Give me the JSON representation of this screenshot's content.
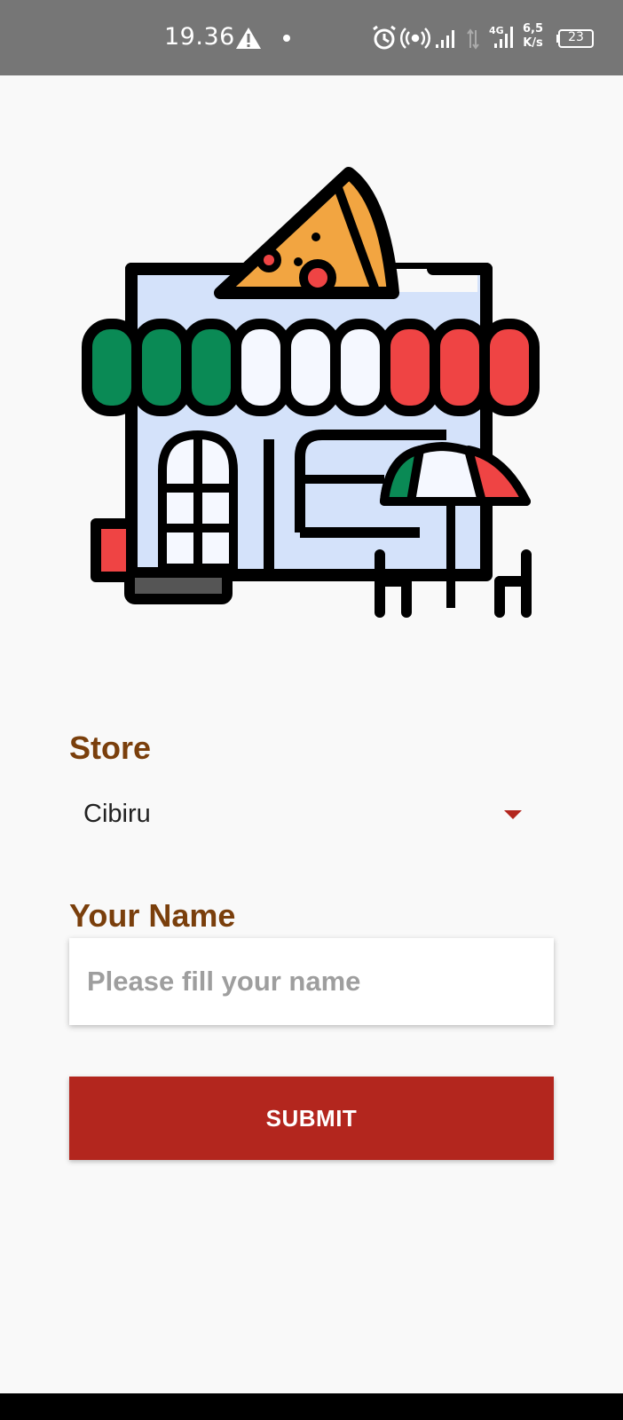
{
  "status_bar": {
    "time": "19.36",
    "network_type": "4G",
    "speed_value": "6,5",
    "speed_unit": "K/s",
    "battery": "23",
    "icons": [
      "warning-icon",
      "dot-icon",
      "alarm-icon",
      "hotspot-icon",
      "signal-icon",
      "data-arrows-icon",
      "signal-4g-icon",
      "battery-icon"
    ]
  },
  "illustration": {
    "name": "pizza-store-icon",
    "colors": {
      "green": "#0a8a55",
      "white": "#f5f8ff",
      "red": "#ef4444",
      "pizza": "#f2a541",
      "building": "#d4e2fa",
      "outline": "#000000"
    }
  },
  "form": {
    "store_label": "Store",
    "store_value": "Cibiru",
    "name_label": "Your Name",
    "name_placeholder": "Please fill your name",
    "name_value": "",
    "submit_label": "SUBMIT"
  },
  "theme": {
    "label_color": "#7a3f0c",
    "primary": "#b3261e",
    "status_bar_bg": "#767676",
    "background": "#f9f9f9"
  }
}
